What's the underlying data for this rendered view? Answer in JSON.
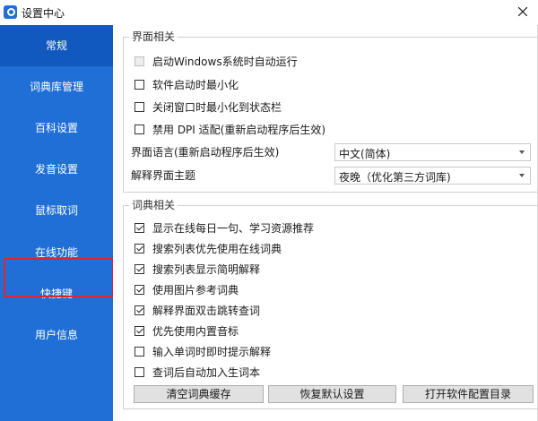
{
  "window": {
    "title": "设置中心"
  },
  "sidebar": {
    "items": [
      {
        "label": "常规"
      },
      {
        "label": "词典库管理"
      },
      {
        "label": "百科设置"
      },
      {
        "label": "发音设置"
      },
      {
        "label": "鼠标取词"
      },
      {
        "label": "在线功能"
      },
      {
        "label": "快捷键"
      },
      {
        "label": "用户信息"
      }
    ],
    "active_index": 0
  },
  "ui_group": {
    "title": "界面相关",
    "options": [
      {
        "label": "启动Windows系统时自动运行",
        "checked": false,
        "disabled": true
      },
      {
        "label": "软件启动时最小化",
        "checked": false
      },
      {
        "label": "关闭窗口时最小化到状态栏",
        "checked": false
      },
      {
        "label": "禁用 DPI 适配(重新启动程序后生效)",
        "checked": false
      }
    ],
    "language": {
      "label": "界面语言(重新启动程序后生效)",
      "value": "中文(简体)"
    },
    "theme": {
      "label": "解释界面主题",
      "value": "夜晚（优化第三方词库)"
    }
  },
  "dict_group": {
    "title": "词典相关",
    "options": [
      {
        "label": "显示在线每日一句、学习资源推荐",
        "checked": true
      },
      {
        "label": "搜索列表优先使用在线词典",
        "checked": true
      },
      {
        "label": "搜索列表显示简明解释",
        "checked": true
      },
      {
        "label": "使用图片参考词典",
        "checked": true
      },
      {
        "label": "解释界面双击跳转查词",
        "checked": true
      },
      {
        "label": "优先使用内置音标",
        "checked": true
      },
      {
        "label": "输入单词时即时提示解释",
        "checked": false
      },
      {
        "label": "查词后自动加入生词本",
        "checked": false
      }
    ]
  },
  "buttons": {
    "clear_cache": "清空词典缓存",
    "restore_default": "恢复默认设置",
    "open_config": "打开软件配置目录"
  },
  "colors": {
    "sidebar": "#1f6fd6",
    "sidebar_active": "#1158bf",
    "highlight": "#e0242a"
  }
}
